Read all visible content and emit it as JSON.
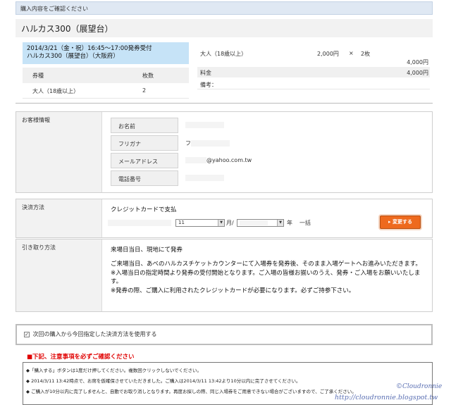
{
  "topbar": {
    "title": "購入内容をご確認ください"
  },
  "event": {
    "title": "ハルカス300（展望台）"
  },
  "schedule": {
    "line1": "2014/3/21（金・祝）16:45～17:00発券受付",
    "line2": "ハルカス300（展望台）（大阪府）"
  },
  "ticket_table": {
    "headers": [
      "券種",
      "枚数"
    ],
    "rows": [
      {
        "type": "大人（18歳以上）",
        "qty": "2"
      }
    ]
  },
  "order": {
    "item": "大人（18歳以上）",
    "unit_price": "2,000円",
    "times": "×",
    "qty": "2枚",
    "subtotal": "4,000円",
    "fee_label": "料金",
    "fee_value": "4,000円",
    "note_label": "備考："
  },
  "customer": {
    "section_label": "お客様情報",
    "fields": [
      {
        "label": "お名前",
        "value": ""
      },
      {
        "label": "フリガナ",
        "value": "フ"
      },
      {
        "label": "メールアドレス",
        "value": "@yahoo.com.tw"
      },
      {
        "label": "電話番号",
        "value": ""
      }
    ]
  },
  "payment": {
    "section_label": "決済方法",
    "method": "クレジットカードで支払",
    "month_value": "11",
    "month_unit": "月/",
    "year_unit": "年",
    "installment": "一括",
    "change_button": "変更する"
  },
  "pickup": {
    "section_label": "引き取り方法",
    "title": "来場日当日、現地にて発券",
    "body1": "ご来場当日、あべのハルカスチケットカウンターにて入場券を発券後、そのまま入場ゲートへお進みいただきます。",
    "body2": "※入場当日の指定時間より発券の受付開始となります。ご入場の皆様お揃いのうえ、発券・ご入場をお願いいたします。",
    "body3": "※発券の際、ご購入に利用されたクレジットカードが必要になります。必ずご持参下さい。"
  },
  "checkbox": {
    "label": "次回の購入から今回指定した決済方法を使用する",
    "checked": true
  },
  "notice": {
    "title": "■下記、注意事項を必ずご確認ください"
  },
  "notes": [
    "◆「購入する」ボタンは1度だけ押してください。複数回クリックしないでください。",
    "◆ 2014/3/11 13:42時点で、お席を仮確保させていただきました。ご購入は2014/3/11 13:42より10分以内に完了させてください。",
    "◆ ご購入が10分以内に完了しませんと、自動でお取り消しとなります。再度お探しの際、同じ入場券をご用意できない場合がございますので、ご了承ください。"
  ],
  "watermark": {
    "line1": "©Cloudronnie",
    "line2": "http://cloudronnie.blogspot.tw"
  }
}
